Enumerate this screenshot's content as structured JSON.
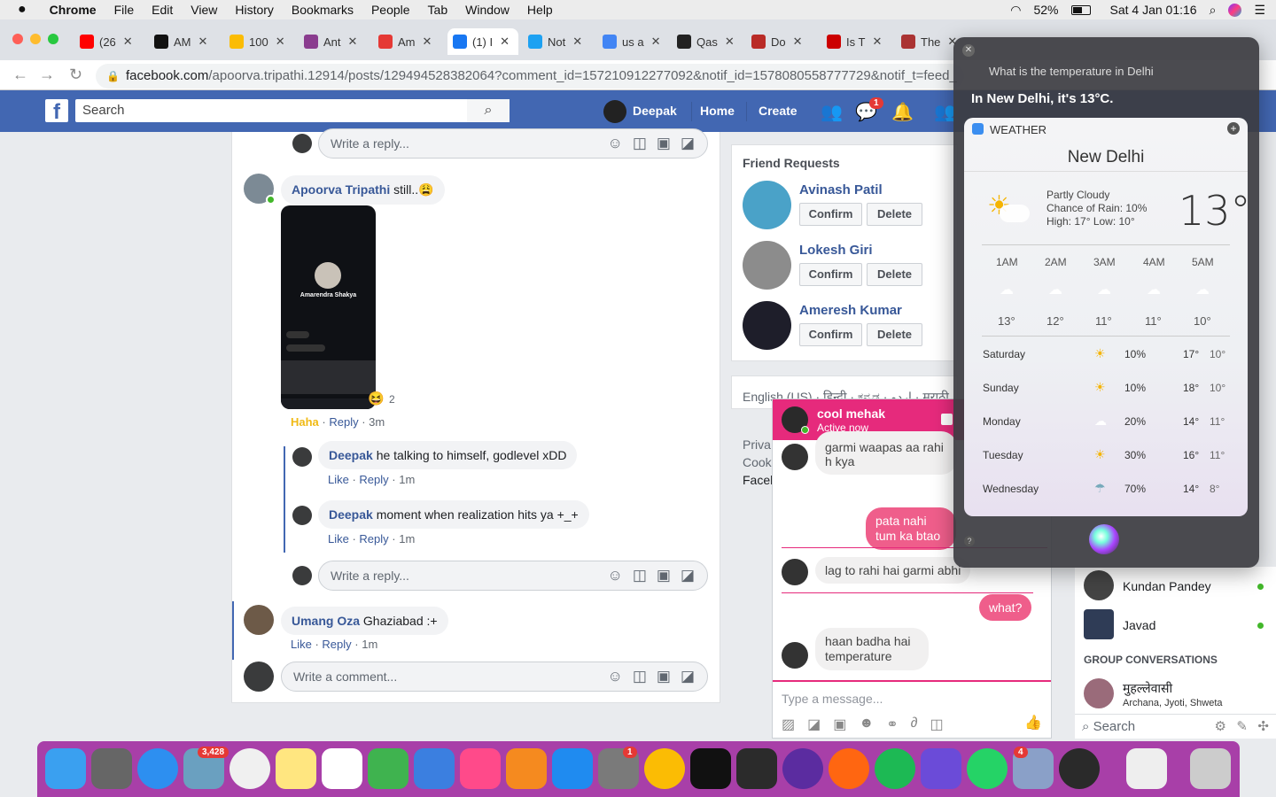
{
  "menubar": {
    "app": "Chrome",
    "items": [
      "File",
      "Edit",
      "View",
      "History",
      "Bookmarks",
      "People",
      "Tab",
      "Window",
      "Help"
    ],
    "battery": "52%",
    "datetime": "Sat 4 Jan  01:16"
  },
  "tabs": [
    {
      "label": "(26",
      "color": "#ff0000"
    },
    {
      "label": "AM",
      "color": "#111111"
    },
    {
      "label": "100",
      "color": "#fbbc04"
    },
    {
      "label": "Ant",
      "color": "#8a3c8f"
    },
    {
      "label": "Am",
      "color": "#e53935"
    },
    {
      "label": "(1) I",
      "color": "#1877f2"
    },
    {
      "label": "Not",
      "color": "#1da1f2"
    },
    {
      "label": "us a",
      "color": "#4285f4"
    },
    {
      "label": "Qas",
      "color": "#222222"
    },
    {
      "label": "Do",
      "color": "#b92b27"
    },
    {
      "label": "Is T",
      "color": "#cc0000"
    },
    {
      "label": "The",
      "color": "#aa3333"
    }
  ],
  "address": {
    "domain": "facebook.com",
    "path": "/apoorva.tripathi.12914/posts/129494528382064?comment_id=157210912277092&notif_id=1578080558777729&notif_t=feed_"
  },
  "fb": {
    "search_placeholder": "Search",
    "user": "Deepak",
    "home": "Home",
    "create": "Create",
    "messenger_count": "1"
  },
  "feed": {
    "write_reply": "Write a reply...",
    "write_comment": "Write a comment...",
    "c1": {
      "name": "Apoorva Tripathi",
      "text": "still..😩",
      "reactions": "2",
      "reaction": "Haha",
      "reply": "Reply",
      "time": "3m"
    },
    "screenshot": {
      "name": "Amarendra Shakya"
    },
    "r1": {
      "name": "Deepak",
      "text": "he talking to himself, godlevel xDD",
      "like": "Like",
      "reply": "Reply",
      "time": "1m"
    },
    "r2": {
      "name": "Deepak",
      "text": "moment when realization hits ya +_+",
      "like": "Like",
      "reply": "Reply",
      "time": "1m"
    },
    "c2": {
      "name": "Umang Oza",
      "text": "Ghaziabad :+",
      "like": "Like",
      "reply": "Reply",
      "time": "1m"
    }
  },
  "friend_requests": {
    "title": "Friend Requests",
    "confirm": "Confirm",
    "delete": "Delete",
    "people": [
      "Avinash Patil",
      "Lokesh Giri",
      "Ameresh Kumar"
    ]
  },
  "languages": "English (US) · हिन्दी · ಕನ್ನಡ · اردو · मराठी",
  "footer_links": [
    "Priva",
    "Cook",
    "Facel"
  ],
  "chat": {
    "name": "cool mehak",
    "status": "Active now",
    "placeholder": "Type a message...",
    "messages": [
      {
        "dir": "in",
        "text": "garmi waapas aa rahi h kya"
      },
      {
        "dir": "out",
        "text": "pata nahi tum ka btao"
      },
      {
        "dir": "in",
        "text": "lag to rahi hai garmi abhi"
      },
      {
        "dir": "out",
        "text": "what?"
      },
      {
        "dir": "in",
        "text": "haan badha hai temperature"
      }
    ]
  },
  "contacts": {
    "people": [
      "Kundan Pandey",
      "Javad"
    ],
    "group_title": "GROUP CONVERSATIONS",
    "group_name": "मुहल्लेवासी",
    "group_members": "Archana, Jyoti, Shweta",
    "search": "Search"
  },
  "siri": {
    "query": "What is the temperature in Delhi",
    "answer": "In New Delhi, it's 13°C.",
    "weather": {
      "header": "WEATHER",
      "city": "New Delhi",
      "condition": "Partly Cloudy",
      "rain": "Chance of Rain: 10%",
      "highlow": "High: 17° Low: 10°",
      "temp": "13°",
      "hours": [
        {
          "h": "1AM",
          "t": "13°"
        },
        {
          "h": "2AM",
          "t": "12°"
        },
        {
          "h": "3AM",
          "t": "11°"
        },
        {
          "h": "4AM",
          "t": "11°"
        },
        {
          "h": "5AM",
          "t": "10°"
        }
      ],
      "days": [
        {
          "d": "Saturday",
          "p": "10%",
          "hi": "17°",
          "lo": "10°",
          "icon": "sun"
        },
        {
          "d": "Sunday",
          "p": "10%",
          "hi": "18°",
          "lo": "10°",
          "icon": "sun"
        },
        {
          "d": "Monday",
          "p": "20%",
          "hi": "14°",
          "lo": "11°",
          "icon": "cloud"
        },
        {
          "d": "Tuesday",
          "p": "30%",
          "hi": "16°",
          "lo": "11°",
          "icon": "sun-rain"
        },
        {
          "d": "Wednesday",
          "p": "70%",
          "hi": "14°",
          "lo": "8°",
          "icon": "rain"
        }
      ]
    }
  },
  "dock": {
    "photos_badge": "3,428",
    "settings_badge": "1",
    "whatsapp_badge": "4"
  }
}
